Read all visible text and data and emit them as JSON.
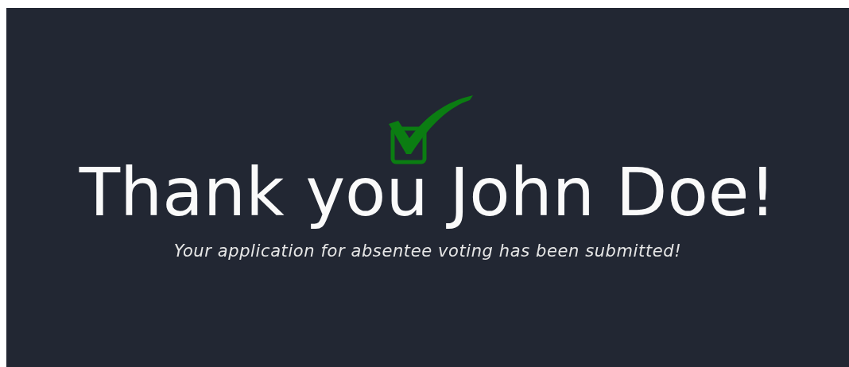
{
  "title": "Thank you John Doe!",
  "message": "Your application for absentee voting has been submitted!"
}
